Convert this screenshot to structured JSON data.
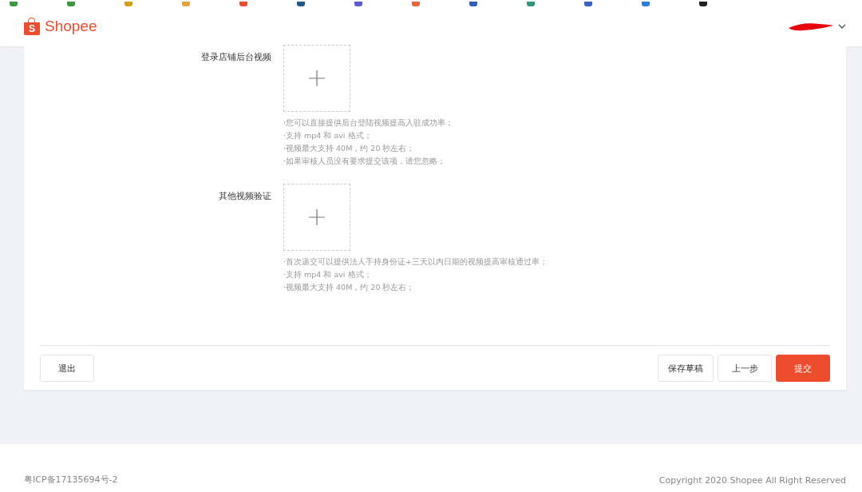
{
  "header": {
    "logo_mark": "S",
    "logo_text": "Shopee"
  },
  "uploads": [
    {
      "label": "登录店铺后台视频",
      "hints": [
        "·您可以直接提供后台登陆视频提高入驻成功率；",
        "·支持 mp4 和 avi 格式；",
        "·视频最大支持 40M，约 20 秒左右；",
        "·如果审核人员没有要求提交该项，请您忽略；"
      ]
    },
    {
      "label": "其他视频验证",
      "hints": [
        "·首次递交可以提供法人手持身份证+三天以内日期的视频提高审核通过率；",
        "·支持 mp4 和 avi 格式；",
        "·视频最大支持 40M，约 20 秒左右；"
      ]
    }
  ],
  "actions": {
    "exit": "退出",
    "buttons": [
      {
        "label": "保存草稿",
        "kind": "default"
      },
      {
        "label": "上一步",
        "kind": "default"
      },
      {
        "label": "提交",
        "kind": "primary"
      }
    ]
  },
  "footer": {
    "icp": "粤ICP备17135694号-2",
    "copyright": "Copyright 2020 Shopee All Right Reserved"
  }
}
